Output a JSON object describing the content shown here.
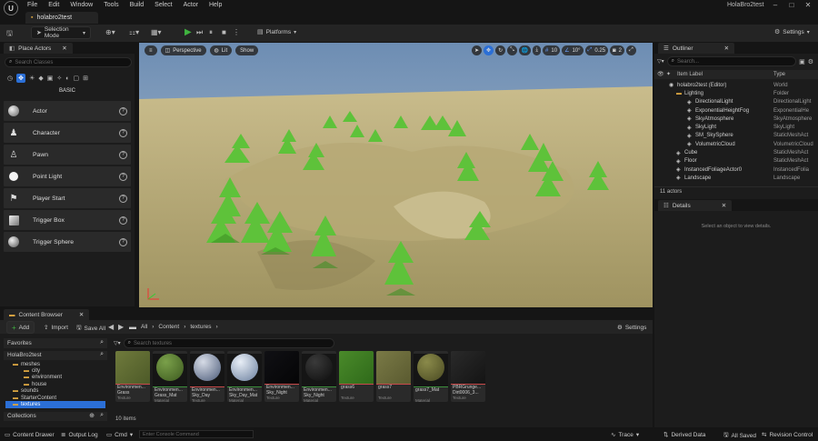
{
  "app": {
    "logo": "U",
    "window_title": "HolaBro2test",
    "tab": "holabro2test"
  },
  "menu": [
    "File",
    "Edit",
    "Window",
    "Tools",
    "Build",
    "Select",
    "Actor",
    "Help"
  ],
  "toolbar": {
    "selection_mode": "Selection Mode",
    "platforms": "Platforms",
    "settings": "Settings"
  },
  "place_actors": {
    "title": "Place Actors",
    "search_placeholder": "Search Classes",
    "category": "BASIC",
    "items": [
      "Actor",
      "Character",
      "Pawn",
      "Point Light",
      "Player Start",
      "Trigger Box",
      "Trigger Sphere"
    ]
  },
  "viewport": {
    "perspective": "Perspective",
    "lit": "Lit",
    "show": "Show",
    "grid": "10",
    "angle": "10°",
    "scale": "0.25",
    "cam": "2"
  },
  "outliner": {
    "title": "Outliner",
    "search_placeholder": "Search...",
    "col_label": "Item Label",
    "col_type": "Type",
    "rows": [
      {
        "name": "holabro2test (Editor)",
        "type": "World",
        "indent": 0
      },
      {
        "name": "Lighting",
        "type": "Folder",
        "indent": 1
      },
      {
        "name": "DirectionalLight",
        "type": "DirectionalLight",
        "indent": 2
      },
      {
        "name": "ExponentialHeightFog",
        "type": "ExponentialHe",
        "indent": 2
      },
      {
        "name": "SkyAtmosphere",
        "type": "SkyAtmosphere",
        "indent": 2
      },
      {
        "name": "SkyLight",
        "type": "SkyLight",
        "indent": 2
      },
      {
        "name": "SM_SkySphere",
        "type": "StaticMeshAct",
        "indent": 2
      },
      {
        "name": "VolumetricCloud",
        "type": "VolumetricCloud",
        "indent": 2
      },
      {
        "name": "Cube",
        "type": "StaticMeshAct",
        "indent": 1
      },
      {
        "name": "Floor",
        "type": "StaticMeshAct",
        "indent": 1
      },
      {
        "name": "InstancedFoliageActor0",
        "type": "InstancedFolia",
        "indent": 1
      },
      {
        "name": "Landscape",
        "type": "Landscape",
        "indent": 1
      }
    ],
    "count": "11 actors"
  },
  "details": {
    "title": "Details",
    "empty": "Select an object to view details."
  },
  "content_browser": {
    "title": "Content Browser",
    "add": "Add",
    "import": "Import",
    "save_all": "Save All",
    "path": [
      "All",
      "Content",
      "textures"
    ],
    "settings": "Settings",
    "favorites": "Favorites",
    "root": "HolaBro2test",
    "collections": "Collections",
    "tree": [
      "meshes",
      "city",
      "environment",
      "house",
      "sounds",
      "StarterContent",
      "textures"
    ],
    "search_placeholder": "Search textures",
    "item_count": "10 items",
    "assets": [
      {
        "name": "Environmen...",
        "sub": "Grass",
        "type": "Texture",
        "c1": "#6f7a3c",
        "c2": "#4d5a28",
        "kind": "flat"
      },
      {
        "name": "Environmen...",
        "sub": "Grass_Mat",
        "type": "Material",
        "c1": "#7aa04a",
        "c2": "#3d5a1f",
        "kind": "sphere"
      },
      {
        "name": "Environmen...",
        "sub": "Sky_Day",
        "type": "Texture",
        "c1": "#d6dbe6",
        "c2": "#4a5a78",
        "kind": "sphere"
      },
      {
        "name": "Environmen...",
        "sub": "Sky_Day_Mat",
        "type": "Material",
        "c1": "#e8eef6",
        "c2": "#6a7f9e",
        "kind": "sphere"
      },
      {
        "name": "Environmen...",
        "sub": "Sky_Night",
        "type": "Texture",
        "c1": "#101014",
        "c2": "#050506",
        "kind": "flat"
      },
      {
        "name": "Environmen...",
        "sub": "Sky_Night",
        "type": "Material",
        "c1": "#3a3a3a",
        "c2": "#0d0d0d",
        "kind": "sphere"
      },
      {
        "name": "grass6",
        "sub": "",
        "type": "Texture",
        "c1": "#4a8a2a",
        "c2": "#2f6a1a",
        "kind": "flat"
      },
      {
        "name": "grass7",
        "sub": "",
        "type": "Texture",
        "c1": "#7a7a46",
        "c2": "#5a5a30",
        "kind": "flat"
      },
      {
        "name": "grass7_Mat",
        "sub": "",
        "type": "Material",
        "c1": "#8a8a4a",
        "c2": "#4a4a22",
        "kind": "sphere"
      },
      {
        "name": "PBRGrunge...",
        "sub": "Dirt0006_3...",
        "type": "Texture",
        "c1": "#2a2a2a",
        "c2": "#141414",
        "kind": "flat"
      }
    ]
  },
  "statusbar": {
    "content_drawer": "Content Drawer",
    "output_log": "Output Log",
    "cmd": "Cmd",
    "console_placeholder": "Enter Console Command",
    "trace": "Trace",
    "derived_data": "Derived Data",
    "all_saved": "All Saved",
    "revision_control": "Revision Control"
  },
  "colors": {
    "accent": "#2b6fd6",
    "play": "#3fb33f",
    "panel": "#1c1c1c",
    "sand": "#bfb282",
    "sky": "#8ba3bd",
    "tree": "#5ec23a"
  }
}
